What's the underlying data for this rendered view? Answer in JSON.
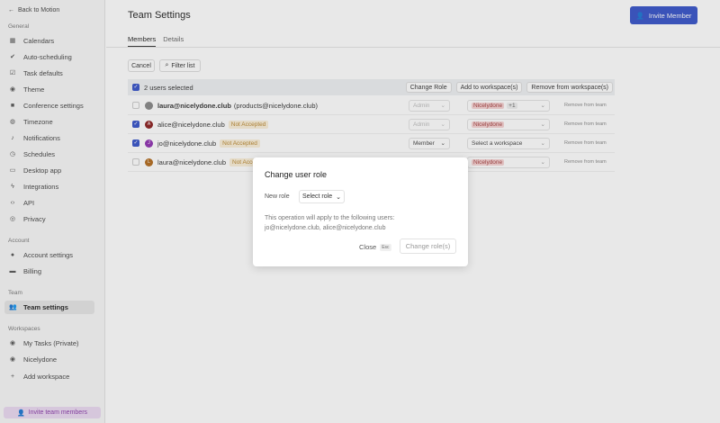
{
  "sidebar": {
    "back": "Back to Motion",
    "general_label": "General",
    "general": [
      {
        "label": "Calendars",
        "icon": "calendar-icon"
      },
      {
        "label": "Auto-scheduling",
        "icon": "check-circle-icon"
      },
      {
        "label": "Task defaults",
        "icon": "checkbox-icon"
      },
      {
        "label": "Theme",
        "icon": "eye-icon"
      },
      {
        "label": "Conference settings",
        "icon": "video-icon"
      },
      {
        "label": "Timezone",
        "icon": "globe-icon"
      },
      {
        "label": "Notifications",
        "icon": "bell-icon"
      },
      {
        "label": "Schedules",
        "icon": "clock-icon"
      },
      {
        "label": "Desktop app",
        "icon": "monitor-icon"
      },
      {
        "label": "Integrations",
        "icon": "bolt-icon"
      },
      {
        "label": "API",
        "icon": "code-icon"
      },
      {
        "label": "Privacy",
        "icon": "fingerprint-icon"
      }
    ],
    "account_label": "Account",
    "account": [
      {
        "label": "Account settings"
      },
      {
        "label": "Billing"
      }
    ],
    "team_label": "Team",
    "team": [
      {
        "label": "Team settings"
      }
    ],
    "workspaces_label": "Workspaces",
    "workspaces": [
      {
        "label": "My Tasks (Private)"
      },
      {
        "label": "Nicelydone"
      }
    ],
    "add_workspace": "Add workspace",
    "invite_team": "Invite team members"
  },
  "header": {
    "title": "Team Settings",
    "invite": "Invite Member"
  },
  "tabs": [
    {
      "label": "Members"
    },
    {
      "label": "Details"
    }
  ],
  "toolbar": {
    "cancel": "Cancel",
    "filter": "Filter list"
  },
  "selection": {
    "count": "2 users selected",
    "change_role": "Change Role",
    "add_ws": "Add to workspace(s)",
    "remove_ws": "Remove from workspace(s)"
  },
  "members": [
    {
      "email": "laura@nicelydone.club",
      "extra": "(products@nicelydone.club)",
      "role": "Admin",
      "ws": "Nicelydone",
      "more": "+1",
      "remove": "Remove from team",
      "checked": false,
      "initial": "",
      "color": "#888"
    },
    {
      "email": "alice@nicelydone.club",
      "badge": "Not Accepted",
      "role": "Admin",
      "ws": "Nicelydone",
      "remove": "Remove from team",
      "checked": true,
      "initial": "A",
      "color": "#8b1e1e"
    },
    {
      "email": "jo@nicelydone.club",
      "badge": "Not Accepted",
      "role": "Member",
      "ws_placeholder": "Select a workspace",
      "remove": "Remove from team",
      "checked": true,
      "initial": "J",
      "color": "#8e2fb0"
    },
    {
      "email": "laura@nicelydone.club",
      "badge": "Not Accepted",
      "ws": "Nicelydone",
      "remove": "Remove from team",
      "checked": false,
      "initial": "L",
      "color": "#b36a1c"
    }
  ],
  "modal": {
    "title": "Change user role",
    "new_role_label": "New role",
    "select_role": "Select role",
    "info": "This operation will apply to the following users:",
    "users": "jo@nicelydone.club, alice@nicelydone.club",
    "close": "Close",
    "esc": "Esc",
    "submit": "Change role(s)"
  }
}
